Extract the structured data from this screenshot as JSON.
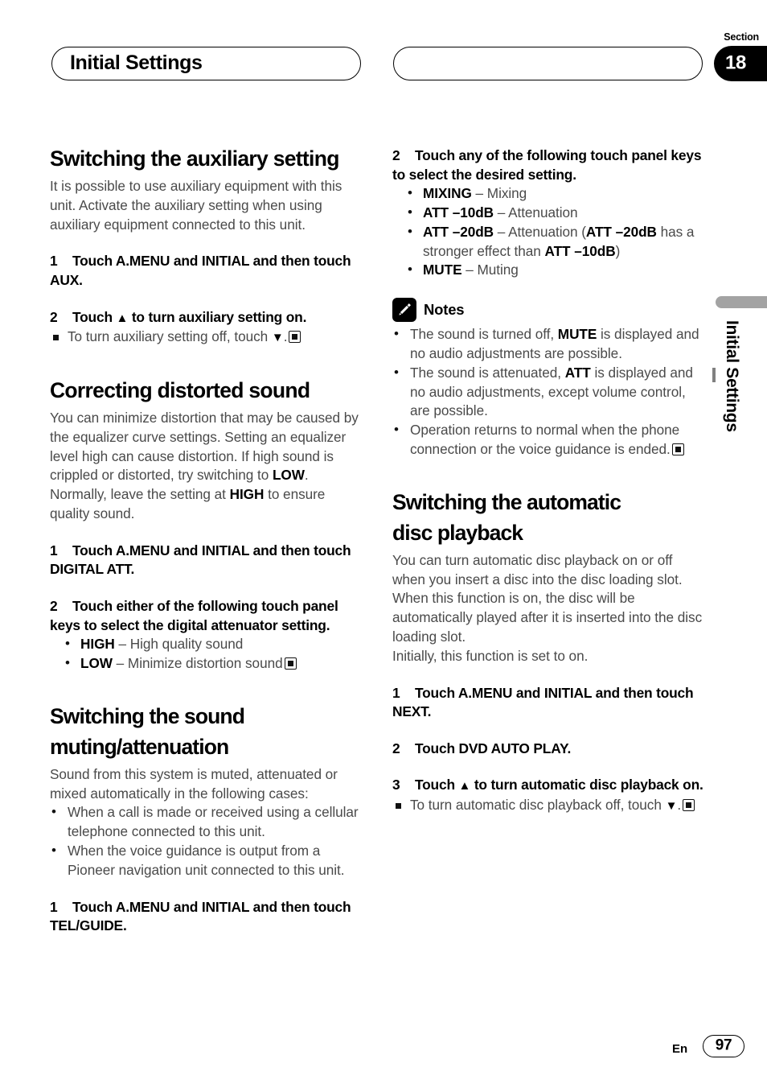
{
  "header": {
    "left_pill_title": "Initial Settings",
    "right_pill_title": "",
    "section_label": "Section",
    "section_number": "18"
  },
  "side_tab": {
    "label": "Initial Settings"
  },
  "footer": {
    "language": "En",
    "page_number": "97"
  },
  "left_column": {
    "section1": {
      "heading": "Switching the auxiliary setting",
      "intro": "It is possible to use auxiliary equipment with this unit. Activate the auxiliary setting when using auxiliary equipment connected to this unit.",
      "step1_num": "1",
      "step1_text": "Touch A.MENU and INITIAL and then touch AUX.",
      "step2_num": "2",
      "step2_prefix": "Touch",
      "step2_arrow": "▲",
      "step2_suffix": "to turn auxiliary setting on.",
      "note_prefix": "To turn auxiliary setting off, touch",
      "note_arrow": "▼",
      "note_suffix": "."
    },
    "section2": {
      "heading": "Correcting distorted sound",
      "intro_part1": "You can minimize distortion that may be caused by the equalizer curve settings. Setting an equalizer level high can cause distortion. If high sound is crippled or distorted, try switching to ",
      "intro_bold1": "LOW",
      "intro_part2": ". Normally, leave the setting at ",
      "intro_bold2": "HIGH",
      "intro_part3": " to ensure quality sound.",
      "step1_num": "1",
      "step1_text": "Touch A.MENU and INITIAL and then touch DIGITAL ATT.",
      "step2_num": "2",
      "step2_text": "Touch either of the following touch panel keys to select the digital attenuator setting.",
      "options": [
        {
          "key": "HIGH",
          "dash": " – ",
          "desc": "High quality sound",
          "endmark": false
        },
        {
          "key": "LOW",
          "dash": " – ",
          "desc": "Minimize distortion sound",
          "endmark": true
        }
      ]
    },
    "section3": {
      "heading_line1": "Switching the sound",
      "heading_line2": "muting/attenuation",
      "intro": "Sound from this system is muted, attenuated or mixed automatically in the following cases:",
      "cases": [
        "When a call is made or received using a cellular telephone connected to this unit.",
        "When the voice guidance is output from a Pioneer navigation unit connected to this unit."
      ],
      "step1_num": "1",
      "step1_text": "Touch A.MENU and INITIAL and then touch TEL/GUIDE."
    }
  },
  "right_column": {
    "step2_continued": {
      "num": "2",
      "text": "Touch any of the following touch panel keys to select the desired setting.",
      "options": [
        {
          "key": "MIXING",
          "dash": " – ",
          "desc": "Mixing"
        },
        {
          "key": "ATT –10dB",
          "dash": " – ",
          "desc": "Attenuation"
        },
        {
          "key": "ATT –20dB",
          "dash": " – ",
          "desc_part1": "Attenuation (",
          "desc_bold1": "ATT –20dB",
          "desc_part2": " has a stronger effect than ",
          "desc_bold2": "ATT –10dB",
          "desc_part3": ")"
        },
        {
          "key": "MUTE",
          "dash": " – ",
          "desc": "Muting"
        }
      ]
    },
    "notes": {
      "icon": "pencil-icon",
      "title": "Notes",
      "items": [
        {
          "part1": "The sound is turned off, ",
          "bold": "MUTE",
          "part2": " is displayed and no audio adjustments are possible.",
          "endmark": false
        },
        {
          "part1": "The sound is attenuated, ",
          "bold": "ATT",
          "part2": " is displayed and no audio adjustments, except volume control, are possible.",
          "endmark": false
        },
        {
          "part1": "Operation returns to normal when the phone connection or the voice guidance is ended.",
          "bold": "",
          "part2": "",
          "endmark": true
        }
      ]
    },
    "section4": {
      "heading_line1": "Switching the automatic",
      "heading_line2": "disc playback",
      "intro_para1": "You can turn automatic disc playback on or off when you insert a disc into the disc loading slot. When this function is on, the disc will be automatically played after it is inserted into the disc loading slot.",
      "intro_para2": "Initially, this function is set to on.",
      "step1_num": "1",
      "step1_text": "Touch A.MENU and INITIAL and then touch NEXT.",
      "step2_num": "2",
      "step2_text": "Touch DVD AUTO PLAY.",
      "step3_num": "3",
      "step3_prefix": "Touch",
      "step3_arrow": "▲",
      "step3_suffix": "to turn automatic disc playback on.",
      "note_prefix": "To turn automatic disc playback off, touch",
      "note_arrow": "▼",
      "note_suffix": "."
    }
  }
}
